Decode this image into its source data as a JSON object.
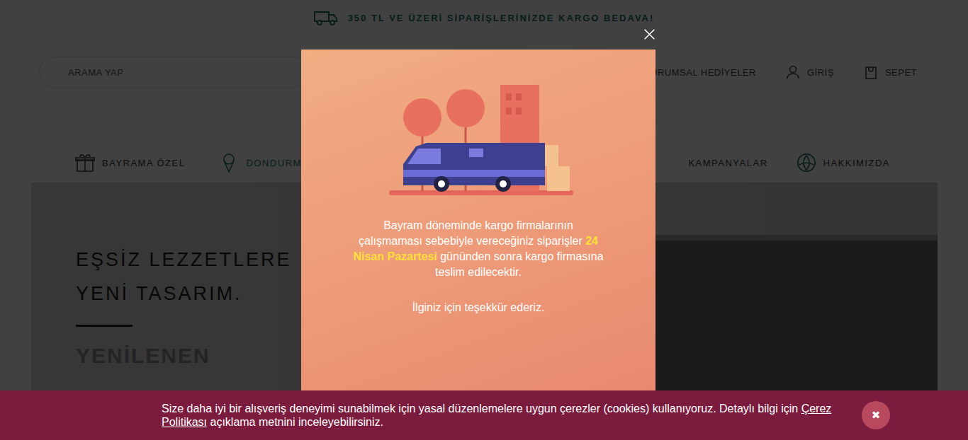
{
  "promo_bar": {
    "text": "350 TL VE ÜZERİ SİPARİŞLERİNİZDE KARGO BEDAVA!"
  },
  "search": {
    "placeholder": "ARAMA YAP"
  },
  "header_links": [
    {
      "label": "KURUMSAL HEDİYELER"
    },
    {
      "label": "GİRİŞ"
    },
    {
      "label": "SEPET"
    }
  ],
  "nav": [
    {
      "label": "BAYRAMA ÖZEL",
      "selected": false
    },
    {
      "label": "DONDURMA",
      "selected": true
    },
    {
      "label": "KAMPANYALAR",
      "selected": false
    },
    {
      "label": "HAKKIMIZDA",
      "selected": false
    }
  ],
  "hero": {
    "lines": [
      "EŞSİZ LEZZETLERE",
      "YENİ TASARIM."
    ],
    "subline": "YENİLENEN"
  },
  "modal": {
    "message_before": "Bayram döneminde kargo firmalarının çalışmaması sebebiyle vereceğiniz siparişler",
    "highlight": "24 Nisan Pazartesi",
    "message_after": "gününden sonra kargo firmasına teslim edilecektir.",
    "thanks": "İlginiz için teşekkür ederiz."
  },
  "cookie_bar": {
    "text_before": "Size daha iyi bir alışveriş deneyimi sunabilmek için yasal düzenlemelere uygun çerezler (cookies) kullanıyoruz. Detaylı bilgi için",
    "link": "Çerez Politikası",
    "text_after": "açıklama metnini inceleyebilirsiniz.",
    "close": "✖"
  }
}
